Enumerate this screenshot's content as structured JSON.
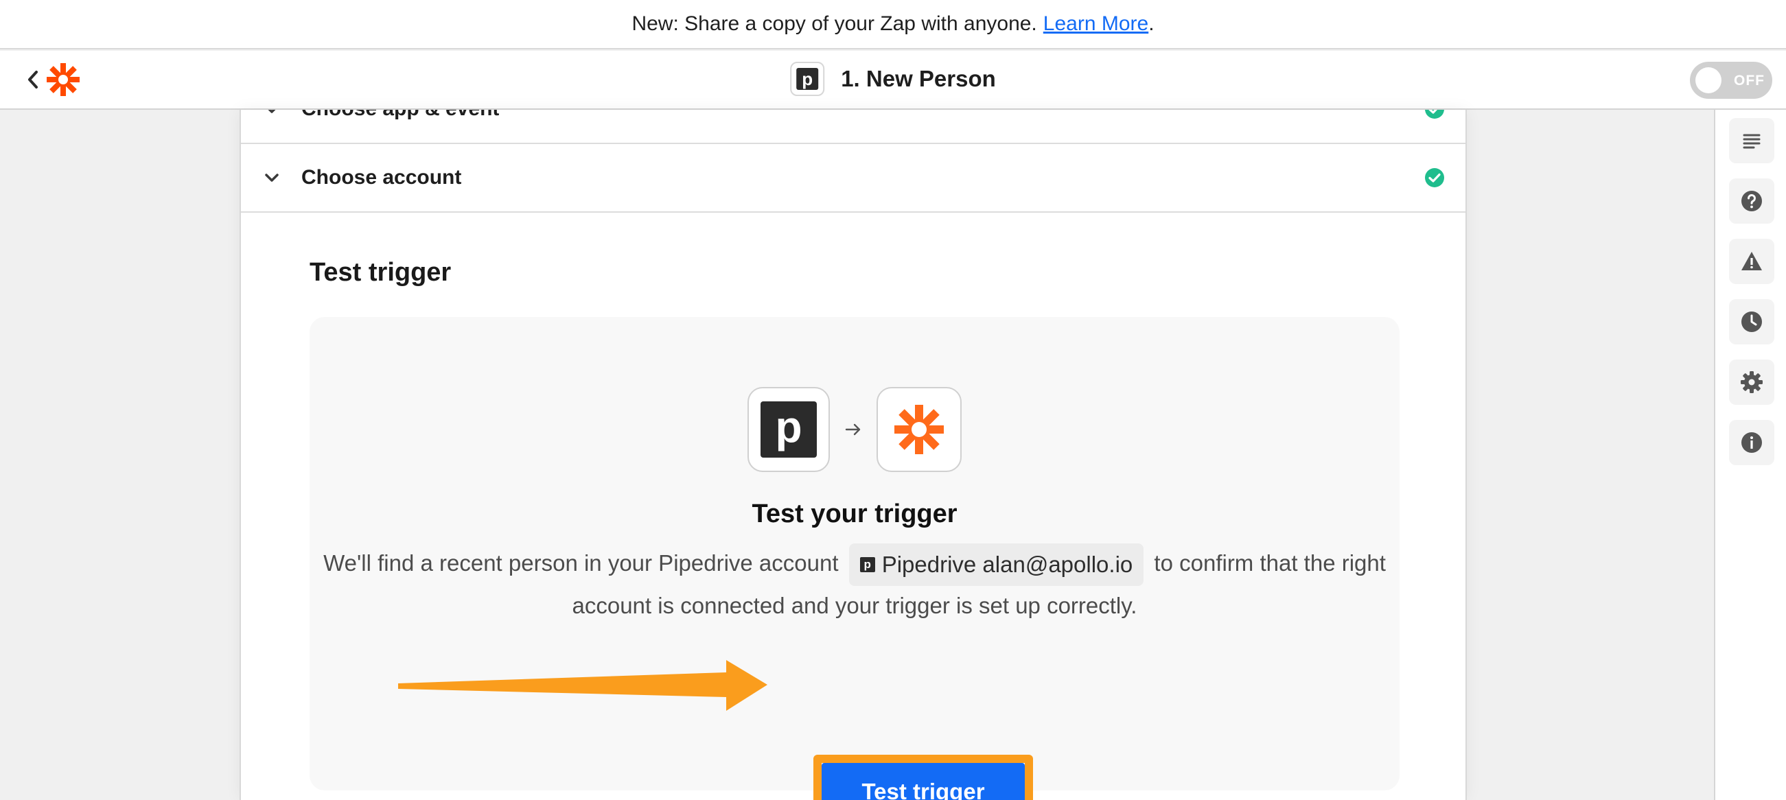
{
  "banner": {
    "text": "New: Share a copy of your Zap with anyone.",
    "link": "Learn More",
    "suffix": "."
  },
  "header": {
    "title": "1. New Person",
    "app_icon_letter": "p",
    "toggle_label": "OFF"
  },
  "sections": {
    "app_event_label": "Choose app & event",
    "account_label": "Choose account"
  },
  "test": {
    "heading": "Test trigger",
    "card_title": "Test your trigger",
    "desc_before": "We'll find a recent person in your Pipedrive account",
    "account_chip": "Pipedrive alan@apollo.io",
    "desc_after": "to confirm that the right account is connected and your trigger is set up correctly.",
    "button_label": "Test trigger"
  },
  "icons": {
    "pipedrive_letter": "p"
  },
  "colors": {
    "brand": "#ff4a00",
    "primary_button": "#136bf5",
    "annotation": "#fa9d1d",
    "success": "#1fbd8d"
  }
}
